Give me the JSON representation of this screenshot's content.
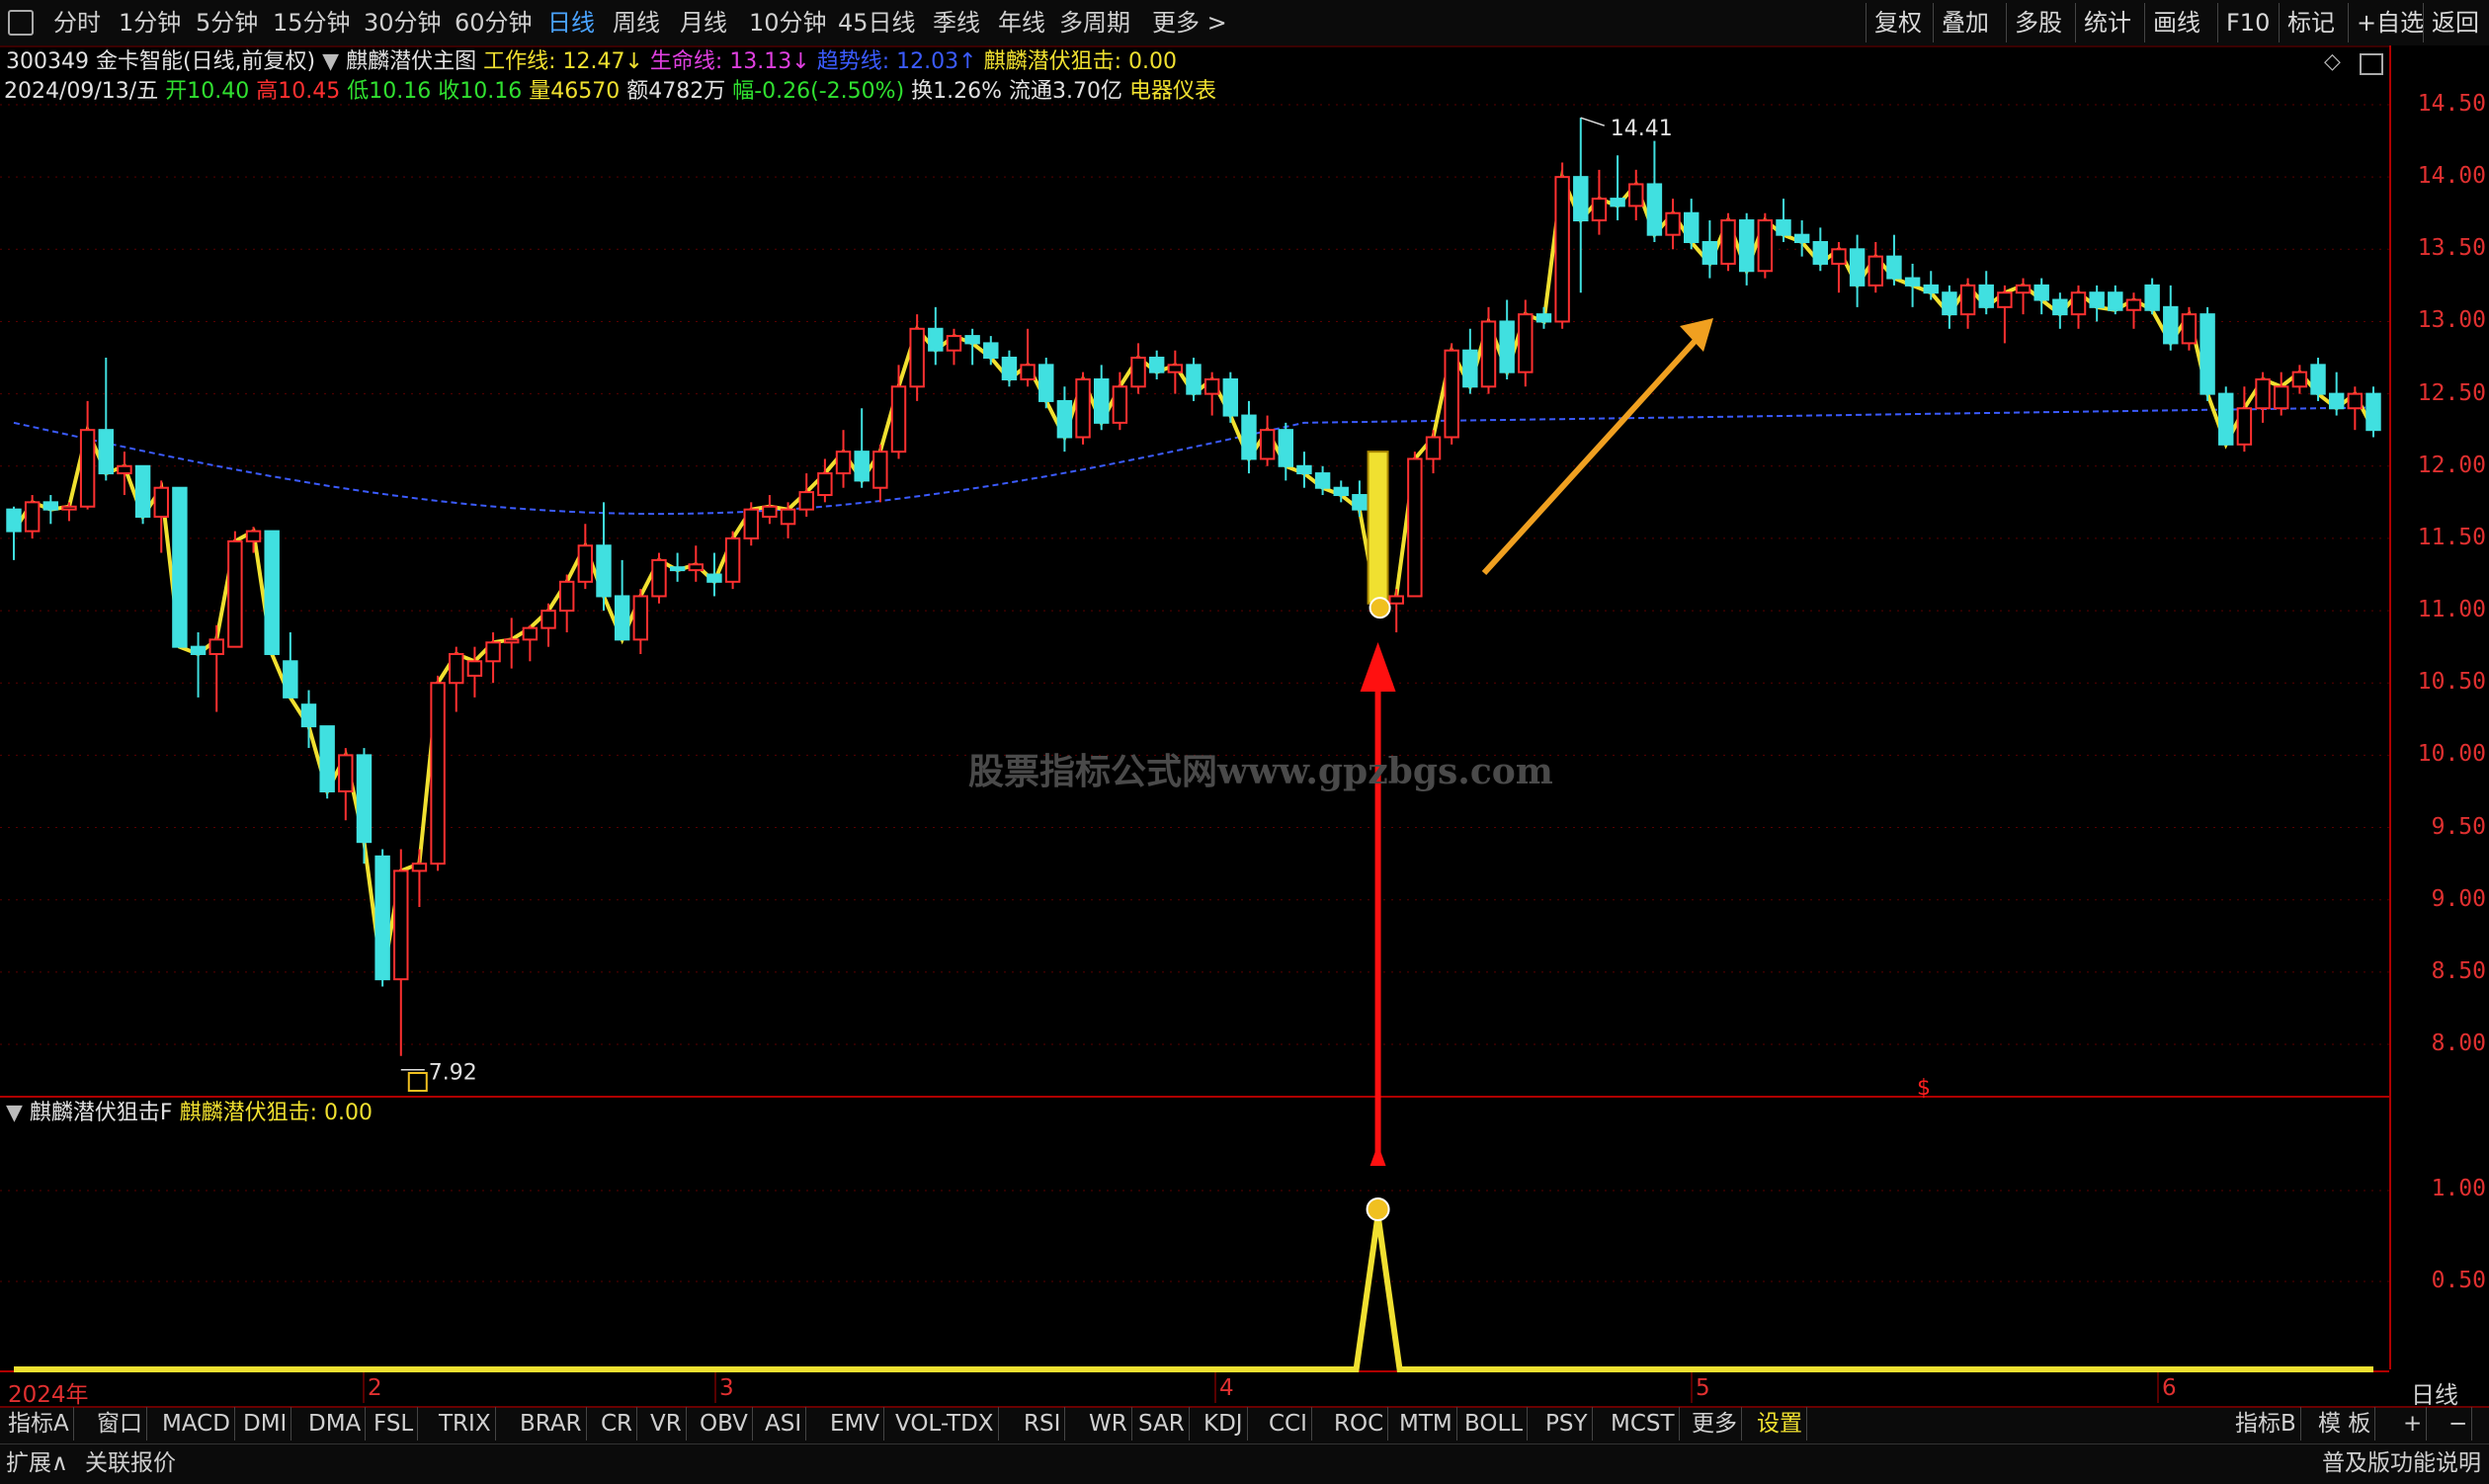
{
  "toolbar": {
    "periods": [
      "分时",
      "1分钟",
      "5分钟",
      "15分钟",
      "30分钟",
      "60分钟",
      "日线",
      "周线",
      "月线",
      "10分钟",
      "45日线",
      "季线",
      "年线",
      "多周期",
      "更多 >"
    ],
    "active_period": "日线",
    "right_buttons": [
      "复权",
      "叠加",
      "多股",
      "统计",
      "画线",
      "F10",
      "标记",
      "+自选",
      "返回"
    ]
  },
  "header": {
    "symbol": "300349 金卡智能(日线,前复权)",
    "indicator_name": "麒麟潜伏主图",
    "work_line_label": "工作线: ",
    "work_line_value": "12.47↓",
    "life_line_label": "生命线: ",
    "life_line_value": "13.13↓",
    "trend_line_label": "趋势线: ",
    "trend_line_value": "12.03↑",
    "strike_label": "麒麟潜伏狙击: ",
    "strike_value": "0.00"
  },
  "quote": {
    "date": "2024/09/13/五",
    "open_label": "开",
    "open": "10.40",
    "high_label": "高",
    "high": "10.45",
    "low_label": "低",
    "low": "10.16",
    "close_label": "收",
    "close": "10.16",
    "vol_label": "量",
    "vol": "46570",
    "amount": "额4782万",
    "change": "幅-0.26(-2.50%)",
    "turnover": "换1.26%",
    "float_cap": "流通3.70亿",
    "sector": "电器仪表"
  },
  "watermark": "股票指标公式网www.gpzbgs.com",
  "price_axis": [
    "14.50",
    "14.00",
    "13.50",
    "13.00",
    "12.50",
    "12.00",
    "11.50",
    "11.00",
    "10.50",
    "10.00",
    "9.50",
    "9.00",
    "8.50",
    "8.00"
  ],
  "annotations": {
    "high": "14.41",
    "low": "7.92"
  },
  "sub_panel": {
    "title": "麒麟潜伏狙击F",
    "label": "麒麟潜伏狙击: ",
    "value": "0.00",
    "axis": [
      "1.00",
      "0.50"
    ]
  },
  "x_axis": {
    "year": "2024年",
    "months": [
      "2",
      "3",
      "4",
      "5",
      "6"
    ],
    "period_label": "日线"
  },
  "indicator_tabs": [
    "指标A",
    "窗口",
    "MACD",
    "DMI",
    "DMA",
    "FSL",
    "TRIX",
    "BRAR",
    "CR",
    "VR",
    "OBV",
    "ASI",
    "EMV",
    "VOL-TDX",
    "RSI",
    "WR",
    "SAR",
    "KDJ",
    "CCI",
    "ROC",
    "MTM",
    "BOLL",
    "PSY",
    "MCST",
    "更多",
    "设置"
  ],
  "indicator_right": [
    "指标B",
    "模 板",
    "+",
    "−"
  ],
  "status": {
    "left1": "扩展∧",
    "left2": "关联报价",
    "right": "普及版功能说明"
  },
  "colors": {
    "up": "#ff3030",
    "down": "#40e0e0",
    "work_line": "#f0e030",
    "life_line": "#e040e0",
    "trend_line": "#3b5bff",
    "signal": "#f0e030"
  },
  "chart_data": {
    "type": "candlestick",
    "ylim": [
      7.7,
      14.6
    ],
    "series_note": "daily OHLC",
    "candles": [
      [
        11.7,
        11.72,
        11.35,
        11.55
      ],
      [
        11.55,
        11.8,
        11.5,
        11.75
      ],
      [
        11.75,
        11.8,
        11.6,
        11.7
      ],
      [
        11.7,
        11.75,
        11.62,
        11.72
      ],
      [
        11.72,
        12.45,
        11.7,
        12.25
      ],
      [
        12.25,
        12.75,
        11.9,
        11.95
      ],
      [
        11.95,
        12.1,
        11.8,
        12.0
      ],
      [
        12.0,
        11.85,
        11.6,
        11.65
      ],
      [
        11.65,
        11.9,
        11.4,
        11.85
      ],
      [
        11.85,
        11.85,
        10.75,
        10.75
      ],
      [
        10.75,
        10.85,
        10.4,
        10.7
      ],
      [
        10.7,
        10.9,
        10.3,
        10.8
      ],
      [
        10.75,
        11.55,
        10.75,
        11.48
      ],
      [
        11.48,
        11.58,
        11.4,
        11.55
      ],
      [
        11.55,
        11.55,
        10.7,
        10.7
      ],
      [
        10.65,
        10.85,
        10.4,
        10.4
      ],
      [
        10.35,
        10.45,
        10.05,
        10.2
      ],
      [
        10.2,
        10.2,
        9.7,
        9.75
      ],
      [
        9.75,
        10.05,
        9.55,
        10.0
      ],
      [
        10.0,
        10.05,
        9.25,
        9.4
      ],
      [
        9.3,
        9.35,
        8.4,
        8.45
      ],
      [
        8.45,
        9.35,
        7.92,
        9.2
      ],
      [
        9.2,
        9.35,
        8.95,
        9.25
      ],
      [
        9.25,
        10.55,
        9.2,
        10.5
      ],
      [
        10.5,
        10.75,
        10.3,
        10.7
      ],
      [
        10.55,
        10.75,
        10.4,
        10.65
      ],
      [
        10.65,
        10.85,
        10.5,
        10.78
      ],
      [
        10.78,
        10.95,
        10.6,
        10.8
      ],
      [
        10.8,
        10.9,
        10.65,
        10.88
      ],
      [
        10.88,
        11.05,
        10.75,
        11.0
      ],
      [
        11.0,
        11.25,
        10.85,
        11.2
      ],
      [
        11.2,
        11.6,
        11.15,
        11.45
      ],
      [
        11.45,
        11.75,
        11.0,
        11.1
      ],
      [
        11.1,
        11.35,
        10.8,
        10.8
      ],
      [
        10.8,
        11.15,
        10.7,
        11.1
      ],
      [
        11.1,
        11.4,
        11.05,
        11.35
      ],
      [
        11.3,
        11.4,
        11.2,
        11.28
      ],
      [
        11.28,
        11.45,
        11.2,
        11.32
      ],
      [
        11.25,
        11.4,
        11.1,
        11.2
      ],
      [
        11.2,
        11.55,
        11.15,
        11.5
      ],
      [
        11.5,
        11.75,
        11.45,
        11.7
      ],
      [
        11.65,
        11.8,
        11.6,
        11.72
      ],
      [
        11.6,
        11.75,
        11.5,
        11.7
      ],
      [
        11.7,
        11.95,
        11.65,
        11.82
      ],
      [
        11.8,
        12.05,
        11.75,
        11.95
      ],
      [
        11.95,
        12.25,
        11.85,
        12.1
      ],
      [
        12.1,
        12.4,
        11.85,
        11.9
      ],
      [
        11.85,
        12.15,
        11.75,
        12.1
      ],
      [
        12.1,
        12.7,
        12.05,
        12.55
      ],
      [
        12.55,
        13.05,
        12.45,
        12.95
      ],
      [
        12.95,
        13.1,
        12.7,
        12.8
      ],
      [
        12.8,
        12.95,
        12.7,
        12.9
      ],
      [
        12.9,
        12.95,
        12.7,
        12.85
      ],
      [
        12.85,
        12.9,
        12.7,
        12.75
      ],
      [
        12.75,
        12.8,
        12.55,
        12.6
      ],
      [
        12.6,
        12.95,
        12.55,
        12.7
      ],
      [
        12.7,
        12.75,
        12.4,
        12.45
      ],
      [
        12.45,
        12.55,
        12.1,
        12.2
      ],
      [
        12.2,
        12.65,
        12.15,
        12.6
      ],
      [
        12.6,
        12.7,
        12.25,
        12.3
      ],
      [
        12.3,
        12.65,
        12.25,
        12.55
      ],
      [
        12.55,
        12.85,
        12.5,
        12.75
      ],
      [
        12.75,
        12.8,
        12.6,
        12.65
      ],
      [
        12.65,
        12.8,
        12.5,
        12.7
      ],
      [
        12.7,
        12.75,
        12.45,
        12.5
      ],
      [
        12.5,
        12.65,
        12.35,
        12.6
      ],
      [
        12.6,
        12.65,
        12.3,
        12.35
      ],
      [
        12.35,
        12.45,
        11.95,
        12.05
      ],
      [
        12.05,
        12.35,
        12.0,
        12.25
      ],
      [
        12.25,
        12.3,
        11.9,
        12.0
      ],
      [
        12.0,
        12.1,
        11.85,
        11.95
      ],
      [
        11.95,
        12.0,
        11.8,
        11.85
      ],
      [
        11.85,
        11.9,
        11.75,
        11.8
      ],
      [
        11.8,
        11.9,
        11.65,
        11.7
      ],
      [
        11.7,
        11.75,
        11.0,
        11.0
      ],
      [
        11.05,
        11.15,
        10.85,
        11.1
      ],
      [
        11.1,
        12.1,
        11.1,
        12.05
      ],
      [
        12.05,
        12.25,
        11.95,
        12.2
      ],
      [
        12.2,
        12.85,
        12.15,
        12.8
      ],
      [
        12.8,
        12.95,
        12.5,
        12.55
      ],
      [
        12.55,
        13.1,
        12.5,
        13.0
      ],
      [
        13.0,
        13.15,
        12.6,
        12.65
      ],
      [
        12.65,
        13.15,
        12.55,
        13.05
      ],
      [
        13.05,
        13.1,
        12.95,
        13.0
      ],
      [
        13.0,
        14.1,
        12.95,
        14.0
      ],
      [
        14.0,
        14.41,
        13.2,
        13.7
      ],
      [
        13.7,
        14.05,
        13.6,
        13.85
      ],
      [
        13.85,
        14.15,
        13.7,
        13.8
      ],
      [
        13.8,
        14.05,
        13.7,
        13.95
      ],
      [
        13.95,
        14.25,
        13.55,
        13.6
      ],
      [
        13.6,
        13.85,
        13.5,
        13.75
      ],
      [
        13.75,
        13.85,
        13.5,
        13.55
      ],
      [
        13.55,
        13.7,
        13.3,
        13.4
      ],
      [
        13.4,
        13.75,
        13.35,
        13.7
      ],
      [
        13.7,
        13.75,
        13.25,
        13.35
      ],
      [
        13.35,
        13.75,
        13.3,
        13.7
      ],
      [
        13.7,
        13.85,
        13.55,
        13.6
      ],
      [
        13.6,
        13.7,
        13.45,
        13.55
      ],
      [
        13.55,
        13.65,
        13.35,
        13.4
      ],
      [
        13.4,
        13.55,
        13.2,
        13.5
      ],
      [
        13.5,
        13.6,
        13.1,
        13.25
      ],
      [
        13.25,
        13.55,
        13.2,
        13.45
      ],
      [
        13.45,
        13.6,
        13.25,
        13.3
      ],
      [
        13.3,
        13.4,
        13.1,
        13.25
      ],
      [
        13.25,
        13.35,
        13.15,
        13.2
      ],
      [
        13.2,
        13.25,
        12.95,
        13.05
      ],
      [
        13.05,
        13.3,
        12.95,
        13.25
      ],
      [
        13.25,
        13.35,
        13.05,
        13.1
      ],
      [
        13.1,
        13.25,
        12.85,
        13.2
      ],
      [
        13.2,
        13.3,
        13.05,
        13.25
      ],
      [
        13.25,
        13.3,
        13.05,
        13.15
      ],
      [
        13.15,
        13.2,
        12.95,
        13.05
      ],
      [
        13.05,
        13.25,
        12.95,
        13.2
      ],
      [
        13.2,
        13.25,
        13.0,
        13.1
      ],
      [
        13.2,
        13.25,
        13.05,
        13.08
      ],
      [
        13.08,
        13.2,
        12.95,
        13.15
      ],
      [
        13.25,
        13.3,
        13.05,
        13.08
      ],
      [
        13.1,
        13.25,
        12.8,
        12.85
      ],
      [
        12.85,
        13.1,
        12.8,
        13.05
      ],
      [
        13.05,
        13.1,
        12.45,
        12.5
      ],
      [
        12.5,
        12.55,
        12.15,
        12.15
      ],
      [
        12.15,
        12.55,
        12.1,
        12.4
      ],
      [
        12.4,
        12.65,
        12.3,
        12.6
      ],
      [
        12.4,
        12.65,
        12.35,
        12.55
      ],
      [
        12.55,
        12.7,
        12.5,
        12.65
      ],
      [
        12.7,
        12.75,
        12.45,
        12.5
      ],
      [
        12.5,
        12.65,
        12.35,
        12.4
      ],
      [
        12.4,
        12.55,
        12.25,
        12.5
      ],
      [
        12.5,
        12.55,
        12.2,
        12.25
      ]
    ],
    "signal_index": 74
  }
}
